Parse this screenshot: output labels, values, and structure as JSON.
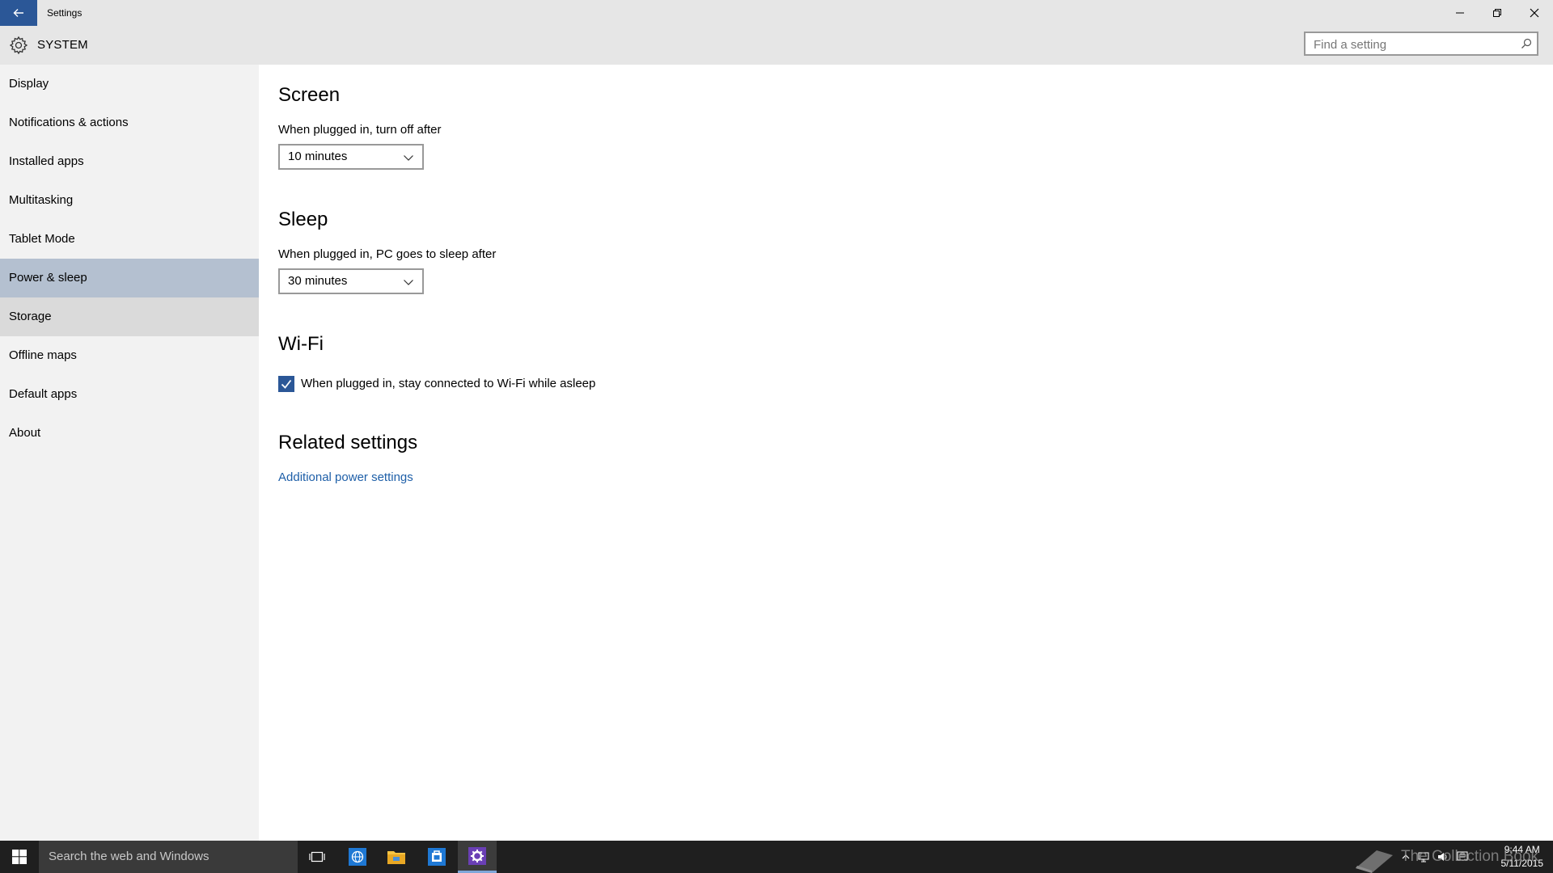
{
  "window": {
    "title": "Settings",
    "minimize": "minimize",
    "restore": "restore",
    "close": "close"
  },
  "header": {
    "title": "SYSTEM",
    "search_placeholder": "Find a setting"
  },
  "sidebar": {
    "selected": "Power & sleep",
    "items": [
      {
        "label": "Display"
      },
      {
        "label": "Notifications & actions"
      },
      {
        "label": "Installed apps"
      },
      {
        "label": "Multitasking"
      },
      {
        "label": "Tablet Mode"
      },
      {
        "label": "Power & sleep"
      },
      {
        "label": "Storage"
      },
      {
        "label": "Offline maps"
      },
      {
        "label": "Default apps"
      },
      {
        "label": "About"
      }
    ]
  },
  "main": {
    "screen": {
      "heading": "Screen",
      "label": "When plugged in, turn off after",
      "value": "10 minutes"
    },
    "sleep": {
      "heading": "Sleep",
      "label": "When plugged in, PC goes to sleep after",
      "value": "30 minutes"
    },
    "wifi": {
      "heading": "Wi-Fi",
      "checkbox_label": "When plugged in,  stay connected to Wi-Fi while asleep",
      "checked": true
    },
    "related": {
      "heading": "Related settings",
      "link": "Additional power settings"
    }
  },
  "taskbar": {
    "search_text": "Search the web and Windows",
    "time": "9:44 AM",
    "date": "5/11/2015",
    "watermark": "The Collection Book"
  },
  "colors": {
    "accent": "#2b5797",
    "selected_nav": "#b4c0d0",
    "link": "#1e5fa8",
    "taskbar": "#1f1f1f"
  }
}
